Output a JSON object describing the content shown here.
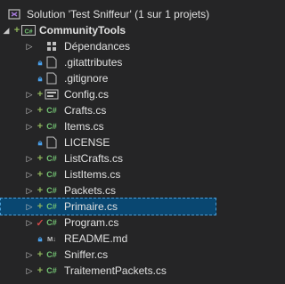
{
  "solution_explorer": {
    "rows": [
      {
        "label": "Solution 'Test Sniffeur' (1 sur 1 projets)",
        "status": "",
        "icon": "solution-icon",
        "expander": ""
      },
      {
        "label": "CommunityTools",
        "status": "plus",
        "icon": "csharp-project-icon",
        "expander": "expanded"
      },
      {
        "label": "Dépendances",
        "status": "",
        "icon": "dependencies-icon",
        "expander": "collapsed"
      },
      {
        "label": ".gitattributes",
        "status": "lock",
        "icon": "file-icon",
        "expander": ""
      },
      {
        "label": ".gitignore",
        "status": "lock",
        "icon": "file-icon",
        "expander": ""
      },
      {
        "label": "Config.cs",
        "status": "plus",
        "icon": "config-cs-icon",
        "expander": "collapsed"
      },
      {
        "label": "Crafts.cs",
        "status": "plus",
        "icon": "csharp-file-icon",
        "expander": "collapsed"
      },
      {
        "label": "Items.cs",
        "status": "plus",
        "icon": "csharp-file-icon",
        "expander": "collapsed"
      },
      {
        "label": "LICENSE",
        "status": "lock",
        "icon": "file-icon",
        "expander": ""
      },
      {
        "label": "ListCrafts.cs",
        "status": "plus",
        "icon": "csharp-file-icon",
        "expander": "collapsed"
      },
      {
        "label": "ListItems.cs",
        "status": "plus",
        "icon": "csharp-file-icon",
        "expander": "collapsed"
      },
      {
        "label": "Packets.cs",
        "status": "plus",
        "icon": "csharp-file-icon",
        "expander": "collapsed"
      },
      {
        "label": "Primaire.cs",
        "status": "plus",
        "icon": "csharp-file-icon",
        "expander": "collapsed",
        "selected": true
      },
      {
        "label": "Program.cs",
        "status": "check",
        "icon": "csharp-file-icon",
        "expander": "collapsed"
      },
      {
        "label": "README.md",
        "status": "lock",
        "icon": "markdown-icon",
        "expander": ""
      },
      {
        "label": "Sniffer.cs",
        "status": "plus",
        "icon": "csharp-file-icon",
        "expander": "collapsed"
      },
      {
        "label": "TraitementPackets.cs",
        "status": "plus",
        "icon": "csharp-file-icon",
        "expander": "collapsed"
      }
    ]
  },
  "colors": {
    "background": "#252526",
    "selection": "#094771",
    "git_added": "#8fb45a",
    "git_modified": "#d04848",
    "git_unchanged": "#4aa3f0",
    "csharp": "#74c374"
  }
}
